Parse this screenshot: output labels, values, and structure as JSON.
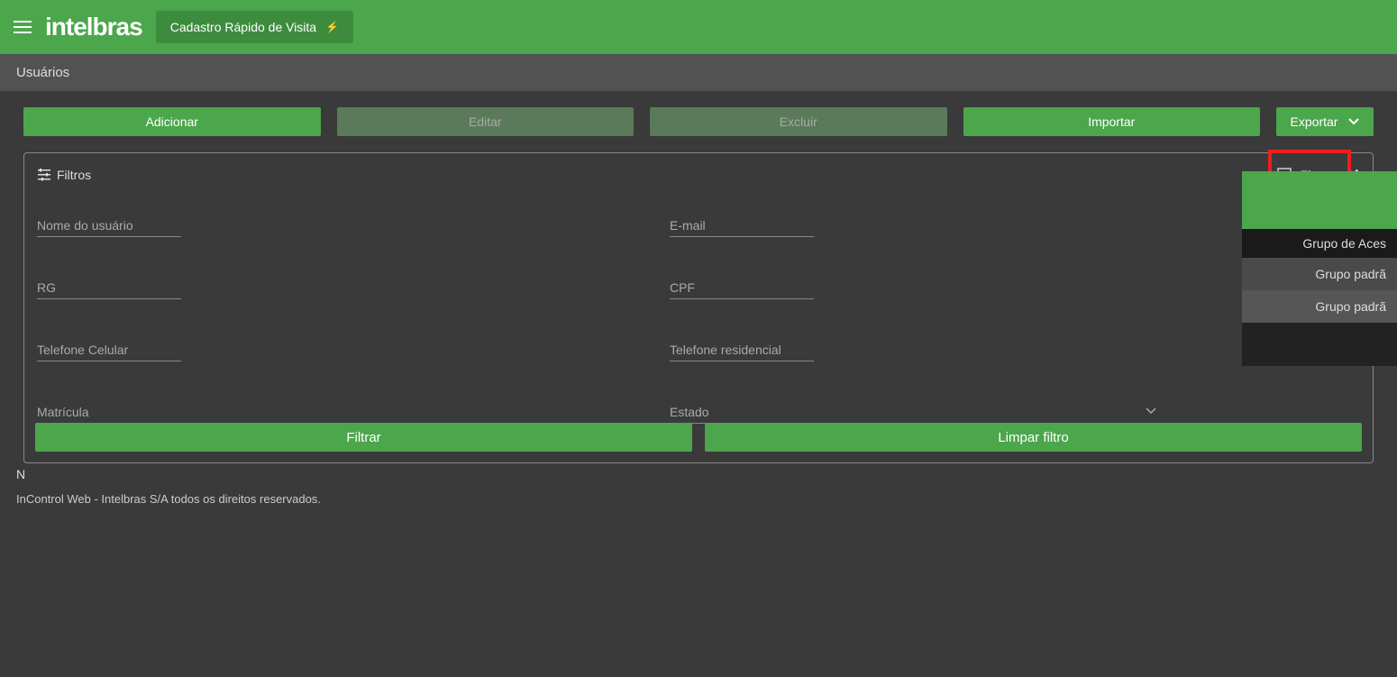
{
  "header": {
    "logo": "intelbras",
    "quick_register": "Cadastro Rápido de Visita"
  },
  "subheader": {
    "title": "Usuários"
  },
  "actions": {
    "add": "Adicionar",
    "edit": "Editar",
    "delete": "Excluir",
    "import": "Importar",
    "export": "Exportar"
  },
  "filters": {
    "title": "Filtros",
    "pin_label": "Fixar",
    "fields": {
      "username": "Nome do usuário",
      "email": "E-mail",
      "rg": "RG",
      "cpf": "CPF",
      "mobile": "Telefone Celular",
      "home_phone": "Telefone residencial",
      "registration": "Matrícula",
      "state": "Estado"
    },
    "filter_btn": "Filtrar",
    "clear_btn": "Limpar filtro"
  },
  "table": {
    "header": "Grupo de Aces",
    "rows": [
      "Grupo padrã",
      "Grupo padrã"
    ]
  },
  "page_indicator": "N",
  "footer": "InControl Web - Intelbras S/A todos os direitos reservados."
}
